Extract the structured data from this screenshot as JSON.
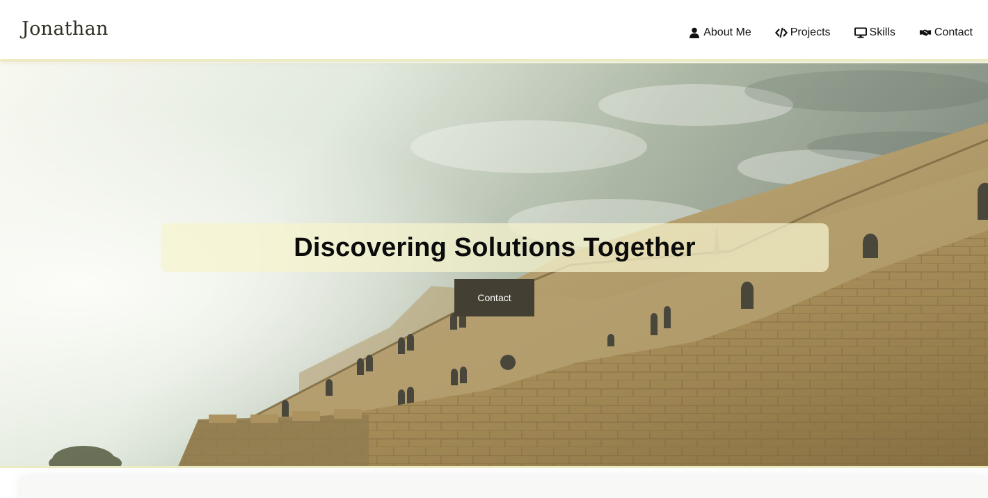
{
  "brand": {
    "name": "Jonathan"
  },
  "nav": {
    "items": [
      {
        "label": "About Me",
        "icon": "user-icon"
      },
      {
        "label": "Projects",
        "icon": "code-icon"
      },
      {
        "label": "Skills",
        "icon": "desktop-icon"
      },
      {
        "label": "Contact",
        "icon": "handshake-icon"
      }
    ]
  },
  "hero": {
    "headline": "Discovering Solutions Together",
    "cta_label": "Contact"
  },
  "colors": {
    "accent": "#ecebc4",
    "button": "#433f33",
    "headline_box": "#f6f4cd"
  }
}
